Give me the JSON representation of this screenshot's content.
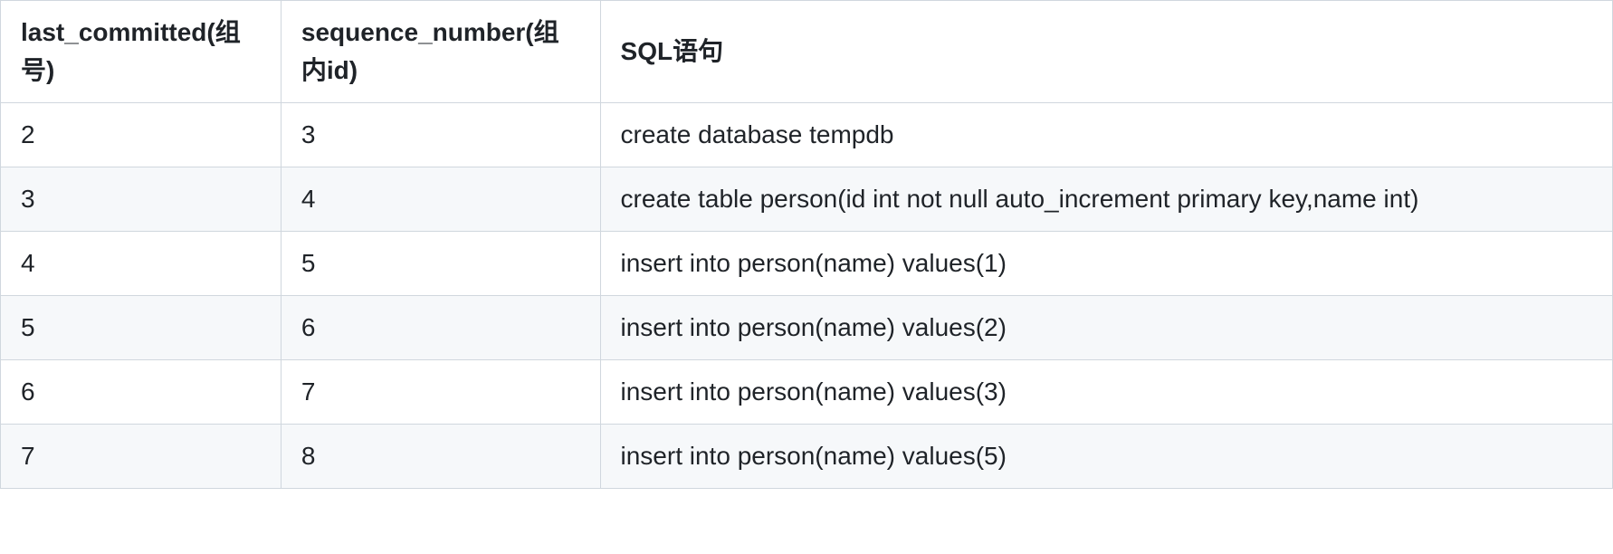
{
  "table": {
    "headers": [
      "last_committed(组号)",
      "sequence_number(组内id)",
      "SQL语句"
    ],
    "rows": [
      {
        "c0": "2",
        "c1": "3",
        "c2": "create database tempdb"
      },
      {
        "c0": "3",
        "c1": "4",
        "c2": "create table person(id int not null auto_increment primary key,name int)"
      },
      {
        "c0": "4",
        "c1": "5",
        "c2": "insert into person(name) values(1)"
      },
      {
        "c0": "5",
        "c1": "6",
        "c2": "insert into person(name) values(2)"
      },
      {
        "c0": "6",
        "c1": "7",
        "c2": "insert into person(name) values(3)"
      },
      {
        "c0": "7",
        "c1": "8",
        "c2": "insert into person(name) values(5)"
      }
    ]
  }
}
